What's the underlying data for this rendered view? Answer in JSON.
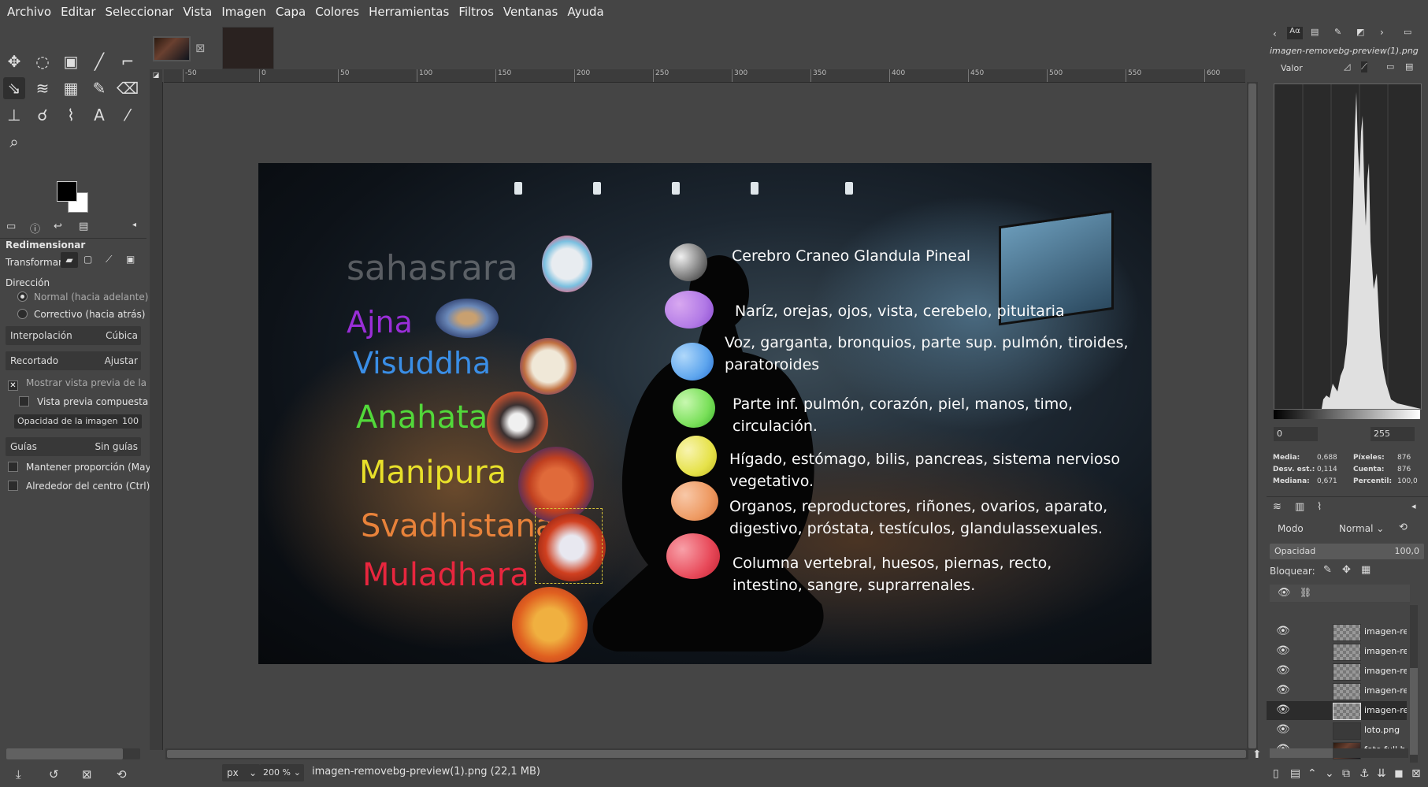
{
  "menu": [
    "Archivo",
    "Editar",
    "Seleccionar",
    "Vista",
    "Imagen",
    "Capa",
    "Colores",
    "Herramientas",
    "Filtros",
    "Ventanas",
    "Ayuda"
  ],
  "tool_options": {
    "title": "Redimensionar",
    "transform_label": "Transformar:",
    "direction_label": "Dirección",
    "direction_normal": "Normal (hacia adelante)",
    "direction_corrective": "Correctivo (hacia atrás)",
    "interpolation_label": "Interpolación",
    "interpolation_value": "Cúbica",
    "clipping_label": "Recortado",
    "clipping_value": "Ajustar",
    "show_preview": "Mostrar vista previa de la ima",
    "composite_preview": "Vista previa compuesta",
    "image_opacity_label": "Opacidad de la imagen",
    "image_opacity_value": "100",
    "guides_label": "Guías",
    "guides_value": "Sin guías",
    "keep_aspect": "Mantener proporción (Mayús",
    "around_center": "Alrededor del centro (Ctrl)"
  },
  "ruler_ticks": [
    "-50",
    "0",
    "50",
    "100",
    "150",
    "200",
    "250",
    "300",
    "350",
    "400",
    "450",
    "500",
    "550",
    "600"
  ],
  "status": {
    "unit": "px",
    "zoom": "200 %",
    "file": "imagen-removebg-preview(1).png (22,1 MB)"
  },
  "image": {
    "chakras": [
      {
        "name": "sahasrara",
        "color": "#4a4a4a",
        "ball": "#9a9a9a",
        "desc1": "Cerebro Craneo Glandula Pineal",
        "desc2": ""
      },
      {
        "name": "Ajna",
        "color": "#9a2ed8",
        "ball": "#b27ae6",
        "desc1": "Naríz, orejas, ojos, vista, cerebelo, pituitaria",
        "desc2": ""
      },
      {
        "name": "Visuddha",
        "color": "#3a8ee6",
        "ball": "#5fa6ee",
        "desc1": "Voz, garganta, bronquios, parte sup. pulmón, tiroides,",
        "desc2": "paratoroides"
      },
      {
        "name": "Anahata",
        "color": "#52d83a",
        "ball": "#7ae05a",
        "desc1": "Parte inf. pulmón, corazón, piel, manos, timo,",
        "desc2": "circulación."
      },
      {
        "name": "Manipura",
        "color": "#e8e02a",
        "ball": "#e6e24a",
        "desc1": "Hígado, estómago, bilis, pancreas, sistema nervioso",
        "desc2": "vegetativo."
      },
      {
        "name": "Svadhistana",
        "color": "#e8823a",
        "ball": "#ee9a62",
        "desc1": "Organos, reproductores, riñones, ovarios, aparato,",
        "desc2": "digestivo, próstata, testículos, glandulassexuales."
      },
      {
        "name": "Muladhara",
        "color": "#e8263e",
        "ball": "#e84a5a",
        "desc1": "Columna vertebral, huesos, piernas, recto,",
        "desc2": "intestino, sangre, suprarrenales."
      }
    ]
  },
  "histogram": {
    "doc_title": "imagen-removebg-preview(1).png",
    "channel": "Valor",
    "range_min": "0",
    "range_max": "255",
    "stats": {
      "media_label": "Media:",
      "media": "0,688",
      "desv_label": "Desv. est.:",
      "desv": "0,114",
      "mediana_label": "Mediana:",
      "mediana": "0,671",
      "pixeles_label": "Píxeles:",
      "pixeles": "876",
      "cuenta_label": "Cuenta:",
      "cuenta": "876",
      "percentil_label": "Percentil:",
      "percentil": "100,0"
    }
  },
  "layers_panel": {
    "mode_label": "Modo",
    "mode_value": "Normal",
    "opacity_label": "Opacidad",
    "opacity_value": "100,0",
    "lock_label": "Bloquear:",
    "layers": [
      "imagen-re",
      "imagen-re",
      "imagen-re",
      "imagen-re",
      "imagen-re",
      "loto.png",
      "foto full h"
    ]
  }
}
